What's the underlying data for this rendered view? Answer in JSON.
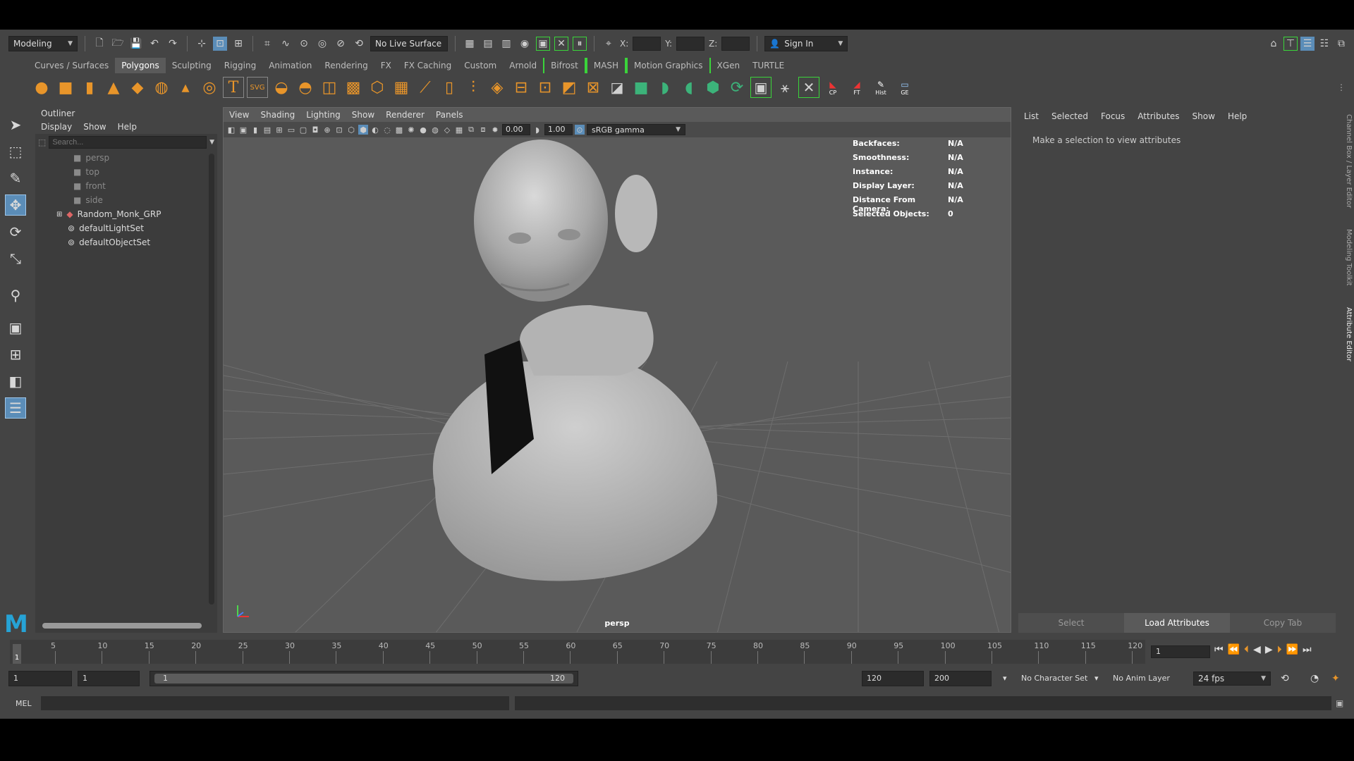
{
  "status_line": {
    "mode_menu": "Modeling",
    "live_surface": "No Live Surface",
    "x_label": "X:",
    "y_label": "Y:",
    "z_label": "Z:",
    "sign_in": "Sign In"
  },
  "shelf_tabs": [
    "Curves / Surfaces",
    "Polygons",
    "Sculpting",
    "Rigging",
    "Animation",
    "Rendering",
    "FX",
    "FX Caching",
    "Custom",
    "Arnold",
    "Bifrost",
    "MASH",
    "Motion Graphics",
    "XGen",
    "TURTLE"
  ],
  "shelf_labels": {
    "cp": "CP",
    "ft": "FT",
    "hist": "Hist",
    "ge": "GE",
    "text_tool": "T",
    "svg_tool": "SVG"
  },
  "outliner": {
    "title": "Outliner",
    "menus": [
      "Display",
      "Show",
      "Help"
    ],
    "search_placeholder": "Search...",
    "items": [
      "persp",
      "top",
      "front",
      "side",
      "Random_Monk_GRP",
      "defaultLightSet",
      "defaultObjectSet"
    ]
  },
  "viewport": {
    "menus": [
      "View",
      "Shading",
      "Lighting",
      "Show",
      "Renderer",
      "Panels"
    ],
    "exposure": "0.00",
    "gamma": "1.00",
    "color_space": "sRGB gamma",
    "hud": [
      {
        "k": "Backfaces:",
        "v": "N/A"
      },
      {
        "k": "Smoothness:",
        "v": "N/A"
      },
      {
        "k": "Instance:",
        "v": "N/A"
      },
      {
        "k": "Display Layer:",
        "v": "N/A"
      },
      {
        "k": "Distance From Camera:",
        "v": "N/A"
      },
      {
        "k": "Selected Objects:",
        "v": "0"
      }
    ],
    "camera_label": "persp"
  },
  "attribute_editor": {
    "menus": [
      "List",
      "Selected",
      "Focus",
      "Attributes",
      "Show",
      "Help"
    ],
    "message": "Make a selection to view attributes",
    "buttons": [
      "Select",
      "Load Attributes",
      "Copy Tab"
    ],
    "side_tabs": [
      "Channel Box / Layer Editor",
      "Modeling Toolkit",
      "Attribute Editor"
    ]
  },
  "time_slider": {
    "current_frame": "1",
    "ticks": [
      "5",
      "10",
      "15",
      "20",
      "25",
      "30",
      "35",
      "40",
      "45",
      "50",
      "55",
      "60",
      "65",
      "70",
      "75",
      "80",
      "85",
      "90",
      "95",
      "100",
      "105",
      "110",
      "115",
      "120"
    ],
    "frame_field": "1"
  },
  "range_slider": {
    "start": "1",
    "playback_start": "1",
    "range_left": "1",
    "range_right": "120",
    "playback_end": "120",
    "end": "200",
    "character_set": "No Character Set",
    "anim_layer": "No Anim Layer",
    "fps": "24 fps"
  },
  "command_line": {
    "label": "MEL"
  }
}
